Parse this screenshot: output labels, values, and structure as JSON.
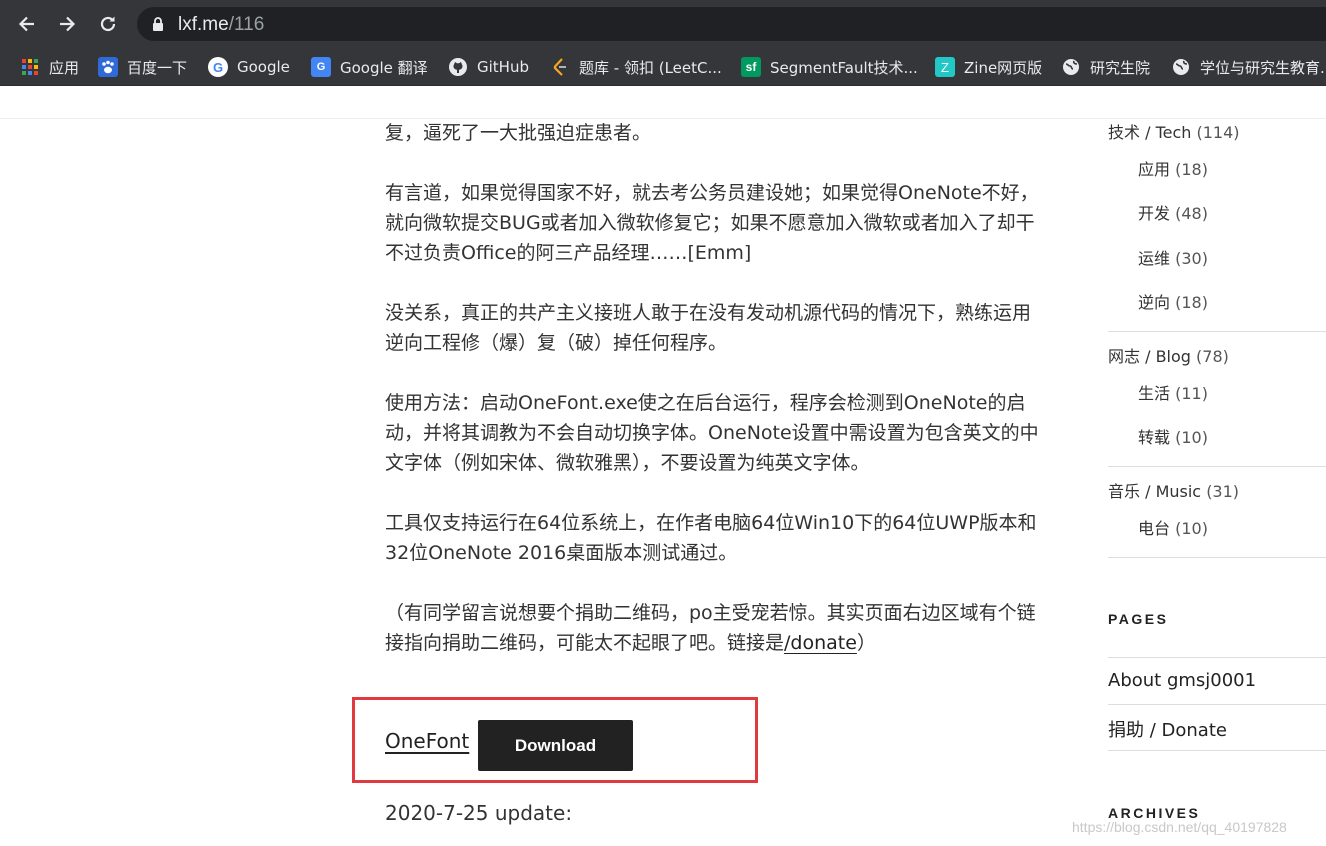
{
  "browser": {
    "url_host": "lxf.me",
    "url_path": "/116",
    "bookmarks": [
      {
        "label": "应用",
        "icon": "apps-grid-icon"
      },
      {
        "label": "百度一下",
        "icon": "baidu-icon"
      },
      {
        "label": "Google",
        "icon": "google-icon"
      },
      {
        "label": "Google 翻译",
        "icon": "google-translate-icon"
      },
      {
        "label": "GitHub",
        "icon": "github-icon"
      },
      {
        "label": "题库 - 领扣 (LeetC...",
        "icon": "leetcode-icon"
      },
      {
        "label": "SegmentFault技术...",
        "icon": "segmentfault-icon"
      },
      {
        "label": "Zine网页版",
        "icon": "zine-icon"
      },
      {
        "label": "研究生院",
        "icon": "globe-icon"
      },
      {
        "label": "学位与研究生教育...",
        "icon": "globe-icon"
      }
    ]
  },
  "article": {
    "p1": "复，逼死了一大批强迫症患者。",
    "p2": "有言道，如果觉得国家不好，就去考公务员建设她；如果觉得OneNote不好，就向微软提交BUG或者加入微软修复它；如果不愿意加入微软或者加入了却干不过负责Office的阿三产品经理……[Emm]",
    "p3": "没关系，真正的共产主义接班人敢于在没有发动机源代码的情况下，熟练运用逆向工程修（爆）复（破）掉任何程序。",
    "p4": "使用方法：启动OneFont.exe使之在后台运行，程序会检测到OneNote的启动，并将其调教为不会自动切换字体。OneNote设置中需设置为包含英文的中文字体（例如宋体、微软雅黑），不要设置为纯英文字体。",
    "p5": "工具仅支持运行在64位系统上，在作者电脑64位Win10下的64位UWP版本和32位OneNote 2016桌面版本测试通过。",
    "p6_text": "（有同学留言说想要个捐助二维码，po主受宠若惊。其实页面右边区域有个链接指向捐助二维码，可能太不起眼了吧。链接是",
    "p6_link": "/donate",
    "p6_end": "）",
    "onefont_link": "OneFont",
    "download_label": "Download",
    "update_text": "2020-7-25 update:"
  },
  "sidebar": {
    "categories": [
      {
        "label": "技术 / Tech",
        "count": "(114)"
      },
      {
        "label": "应用",
        "count": "(18)"
      },
      {
        "label": "开发",
        "count": "(48)"
      },
      {
        "label": "运维",
        "count": "(30)"
      },
      {
        "label": "逆向",
        "count": "(18)"
      },
      {
        "label": "网志 / Blog",
        "count": "(78)"
      },
      {
        "label": "生活",
        "count": "(11)"
      },
      {
        "label": "转载",
        "count": "(10)"
      },
      {
        "label": "音乐 / Music",
        "count": "(31)"
      },
      {
        "label": "电台",
        "count": "(10)"
      }
    ],
    "pages_title": "PAGES",
    "pages": [
      "About gmsj0001",
      "捐助 / Donate"
    ],
    "archives_title": "ARCHIVES"
  },
  "watermark": "https://blog.csdn.net/qq_40197828",
  "colors": {
    "chrome_bg": "#35363a",
    "omnibox_bg": "#202124",
    "highlight_border": "#e0393e",
    "button_bg": "#222222"
  }
}
